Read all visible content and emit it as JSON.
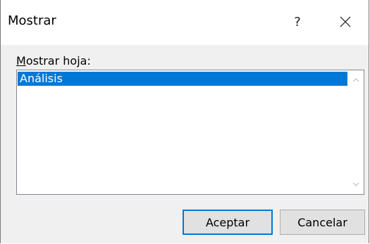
{
  "dialog": {
    "title": "Mostrar",
    "help_label": "?",
    "list_label_prefix": "M",
    "list_label_rest": "ostrar hoja:",
    "items": [
      {
        "label": "Análisis",
        "selected": true
      }
    ],
    "ok_label": "Aceptar",
    "cancel_label": "Cancelar"
  },
  "colors": {
    "selection": "#0078d7",
    "dialog_bg": "#f0f0f0",
    "default_button_border": "#0078d7"
  },
  "icons": {
    "close": "close-icon",
    "scroll_up": "chevron-up-icon",
    "scroll_down": "chevron-down-icon"
  }
}
